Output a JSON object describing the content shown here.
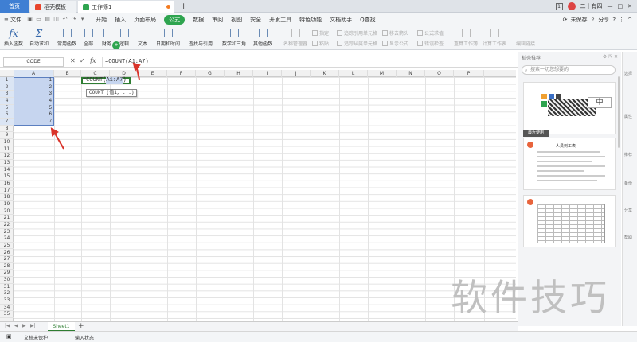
{
  "tabs": {
    "home": "首页",
    "docer": "稻壳模板",
    "workbook": "工作簿1",
    "new_tab": "+"
  },
  "titlebar_right": {
    "badge": "1",
    "user": "二十有四",
    "win_min": "—",
    "win_max": "□",
    "win_close": "✕"
  },
  "menu": {
    "file": "≡ 文件",
    "items": [
      "开始",
      "插入",
      "页面布局",
      "公式",
      "数据",
      "审阅",
      "视图",
      "安全",
      "开发工具",
      "特色功能",
      "文档助手"
    ],
    "search": "Q查找",
    "right": {
      "sync": "未保存",
      "share": "分享",
      "help": "?",
      "more": "⋮",
      "up": "^"
    }
  },
  "ribbon": {
    "insert_function": "插入函数",
    "autosum": "自动求和",
    "common": "常用函数",
    "all": "全部",
    "finance": "财务",
    "logic": "逻辑",
    "text": "文本",
    "datetime": "日期和时间",
    "lookup": "查找与引用",
    "math": "数学和三角",
    "other": "其他函数",
    "name_mgr": "名称管理器",
    "paste": "粘贴",
    "specify": "指定",
    "trace_prec": "追踪引用单元格",
    "trace_dep": "追踪从属单元格",
    "remove_arrows": "移去箭头",
    "show_formula": "显示公式",
    "eval_formula": "公式求值",
    "error_check": "错误检查",
    "recalc_book": "重算工作簿",
    "calc_sheet": "计算工作表",
    "edit_links": "编辑链接",
    "fx_glyph": "fx"
  },
  "formula_bar": {
    "name_box": "CODE",
    "formula": "=COUNT(A1:A7)"
  },
  "grid": {
    "columns": [
      "A",
      "B",
      "C",
      "D",
      "E",
      "F",
      "G",
      "H",
      "I",
      "J",
      "K",
      "L",
      "M",
      "N",
      "O",
      "P"
    ],
    "rows": [
      "1",
      "2",
      "3",
      "4",
      "5",
      "6",
      "7",
      "8",
      "9",
      "10",
      "11",
      "12",
      "13",
      "14",
      "15",
      "16",
      "17",
      "18",
      "19",
      "20",
      "21",
      "22",
      "23",
      "24",
      "25",
      "26",
      "27",
      "28",
      "29",
      "30",
      "31",
      "32",
      "33",
      "34",
      "35"
    ],
    "a_values": [
      "1",
      "2",
      "3",
      "4",
      "5",
      "6",
      "7"
    ],
    "cell_formula_prefix": "=COUNT(",
    "cell_formula_ref": "A1:A7",
    "cell_formula_suffix": ")",
    "tooltip": "COUNT (值1, ...)"
  },
  "panel": {
    "title": "稻壳推荐",
    "search_placeholder": "搜索一切您想要的",
    "recent_label": "最近使用",
    "card1_text": "中",
    "card2_title": "人员到工表",
    "badge": "+"
  },
  "tool_col": [
    "选择",
    "属性",
    "推荐",
    "备份",
    "分享",
    "帮助"
  ],
  "sheets": {
    "tab": "Sheet1",
    "add": "+"
  },
  "status": {
    "protect": "文档未保护",
    "input_mode": "输入状态"
  },
  "watermark": "软件技巧",
  "colors": {
    "accent_green": "#2ea44f",
    "tab_blue": "#3f7fd3",
    "selection": "#c6d5ef",
    "arrow_red": "#d9342b"
  }
}
